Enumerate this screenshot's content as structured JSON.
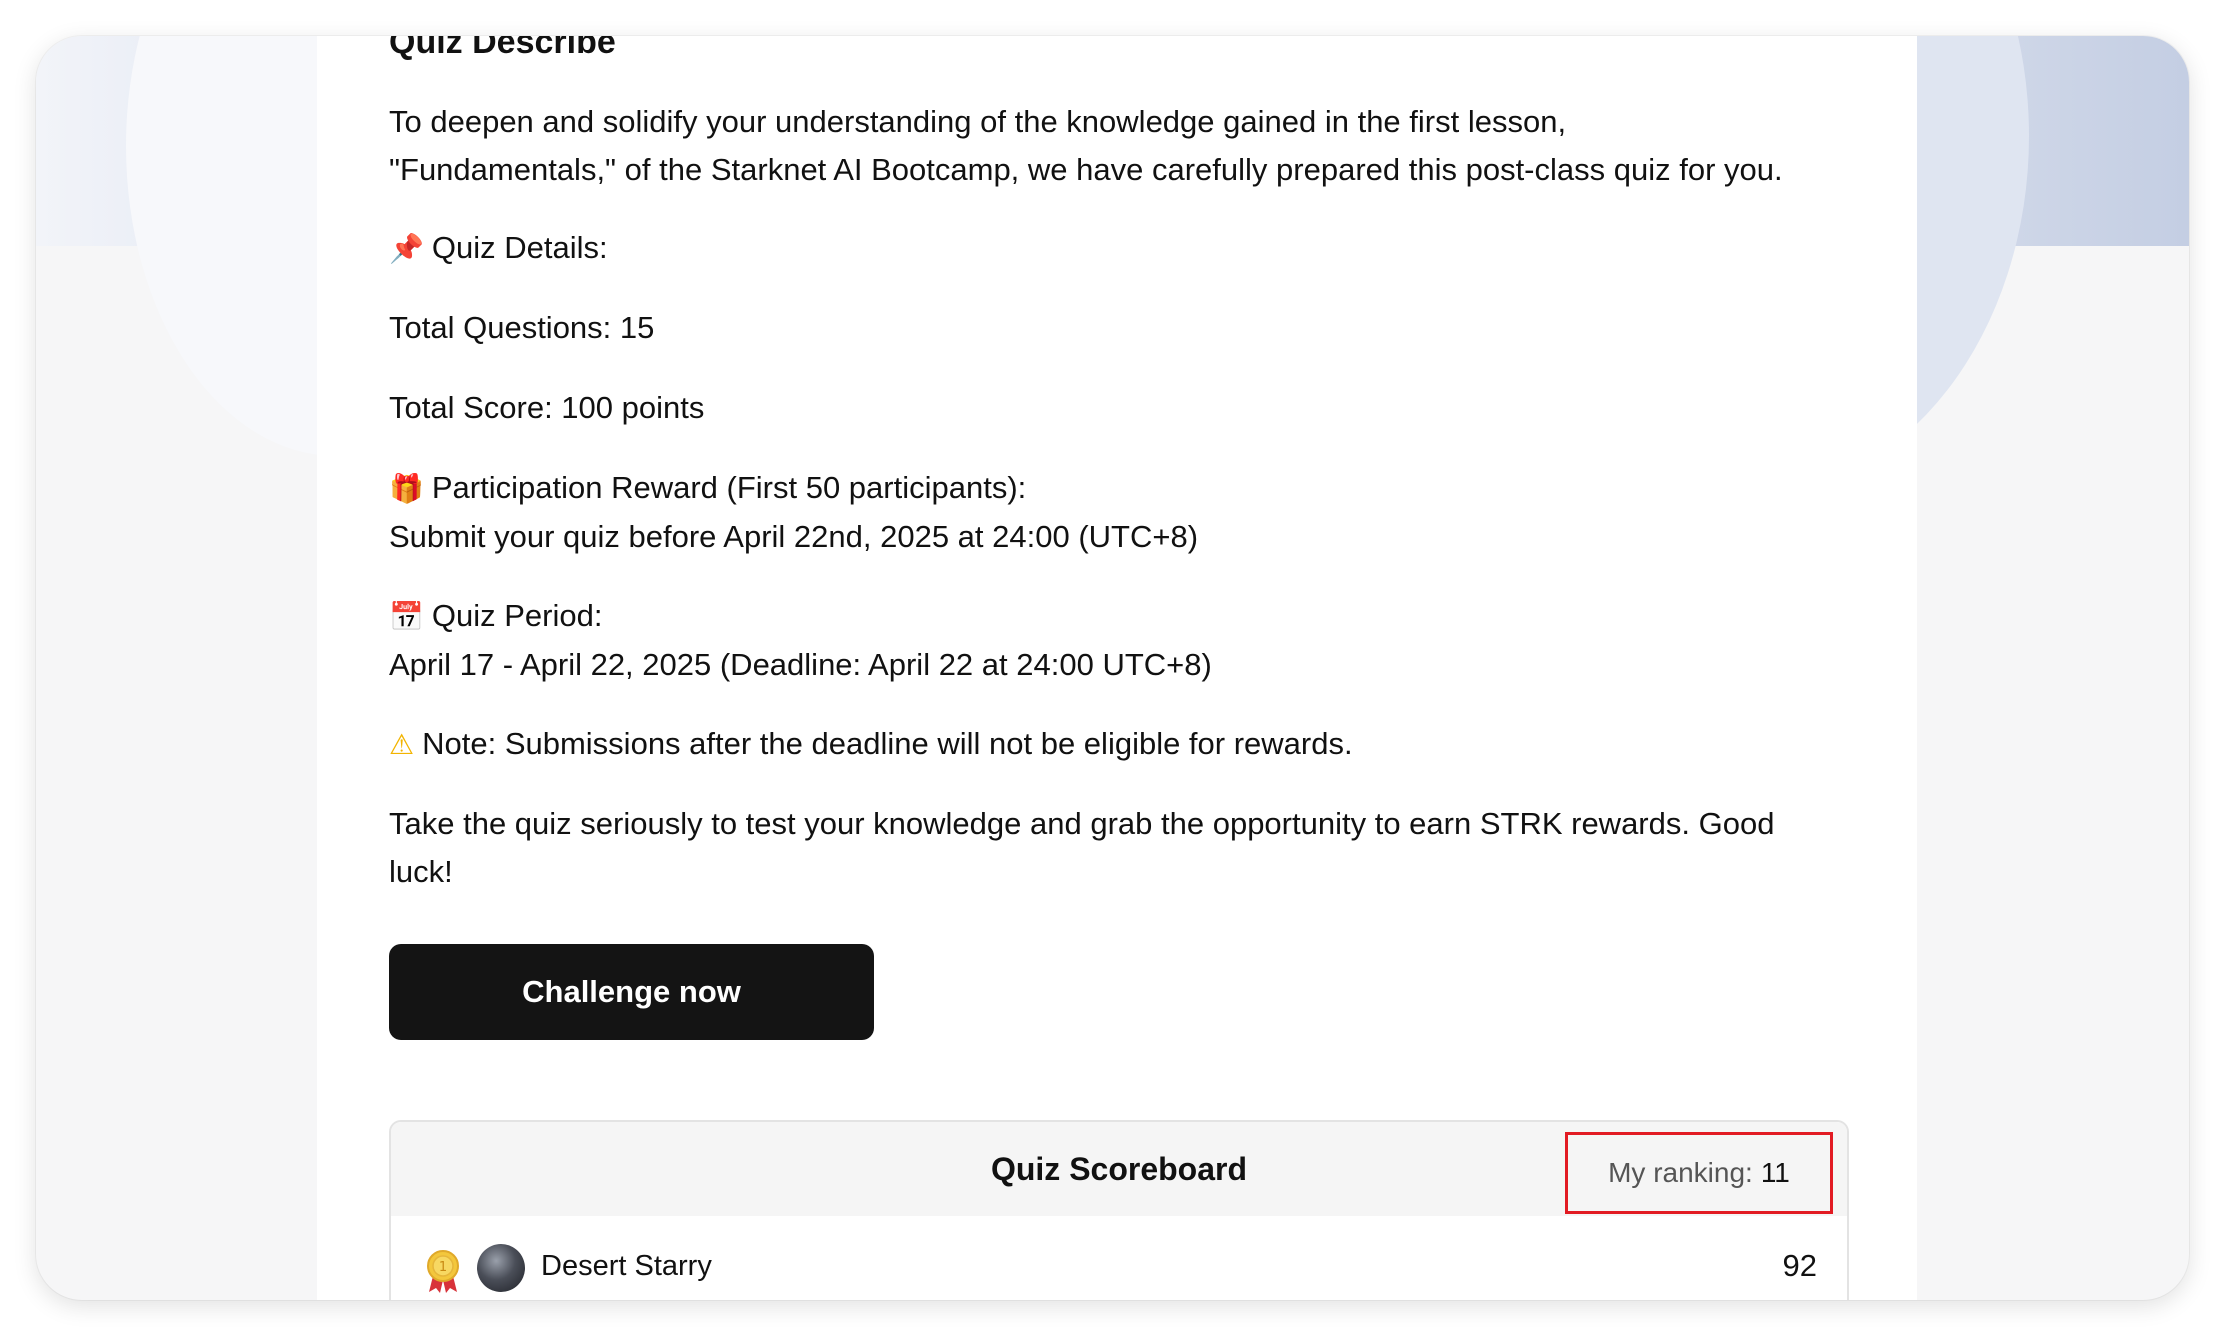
{
  "quiz": {
    "heading": "Quiz Describe",
    "intro_line1": "To deepen and solidify your understanding of the knowledge gained in the first lesson,",
    "intro_line2": "\"Fundamentals,\" of the Starknet AI Bootcamp, we have carefully prepared this post-class quiz for you.",
    "details_label": "Quiz Details:",
    "total_questions": "Total Questions: 15",
    "total_score": "Total Score: 100 points",
    "reward_label": "Participation Reward (First 50 participants):",
    "reward_text": "Submit your quiz before April 22nd, 2025 at 24:00 (UTC+8)",
    "period_label": "Quiz Period:",
    "period_text": "April 17 - April 22, 2025 (Deadline: April 22 at 24:00 UTC+8)",
    "note": "Note: Submissions after the deadline will not be eligible for rewards.",
    "closing_line1": "Take the quiz seriously to test your knowledge and grab the opportunity to earn STRK rewards. Good",
    "closing_line2": "luck!",
    "button_label": "Challenge now"
  },
  "icons": {
    "details": "pushpin-icon",
    "reward": "gift-icon",
    "period": "calendar-icon",
    "note": "warning-icon"
  },
  "scoreboard": {
    "title": "Quiz Scoreboard",
    "ranking_label": "My ranking:",
    "ranking_value": "11",
    "rows": [
      {
        "name": "Desert Starry",
        "score": "92"
      }
    ]
  },
  "colors": {
    "button_bg": "#141414",
    "ranking_highlight": "#e21b23"
  }
}
